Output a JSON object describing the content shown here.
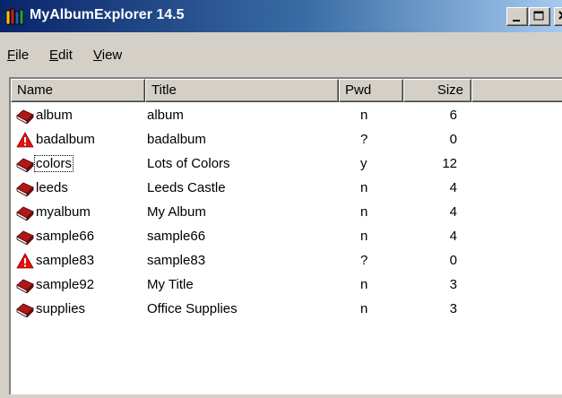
{
  "window": {
    "title": "MyAlbumExplorer 14.5",
    "colors": {
      "titlebar_start": "#0a246a",
      "titlebar_end": "#a6caf0",
      "face": "#d4d0c8"
    }
  },
  "menu": [
    {
      "mnemonic": "F",
      "rest": "ile"
    },
    {
      "mnemonic": "E",
      "rest": "dit"
    },
    {
      "mnemonic": "V",
      "rest": "iew"
    }
  ],
  "columns": {
    "name": "Name",
    "title": "Title",
    "pwd": "Pwd",
    "size": "Size"
  },
  "rows": [
    {
      "icon": "album-book-icon",
      "name": "album",
      "title": "album",
      "pwd": "n",
      "size": "6"
    },
    {
      "icon": "warning-icon",
      "name": "badalbum",
      "title": "badalbum",
      "pwd": "?",
      "size": "0"
    },
    {
      "icon": "album-book-icon",
      "name": "colors",
      "title": "Lots of Colors",
      "pwd": "y",
      "size": "12",
      "focused": true
    },
    {
      "icon": "album-book-icon",
      "name": "leeds",
      "title": "Leeds Castle",
      "pwd": "n",
      "size": "4"
    },
    {
      "icon": "album-book-icon",
      "name": "myalbum",
      "title": "My Album",
      "pwd": "n",
      "size": "4"
    },
    {
      "icon": "album-book-icon",
      "name": "sample66",
      "title": "sample66",
      "pwd": "n",
      "size": "4"
    },
    {
      "icon": "warning-icon",
      "name": "sample83",
      "title": "sample83",
      "pwd": "?",
      "size": "0"
    },
    {
      "icon": "album-book-icon",
      "name": "sample92",
      "title": "My Title",
      "pwd": "n",
      "size": "3"
    },
    {
      "icon": "album-book-icon",
      "name": "supplies",
      "title": "Office Supplies",
      "pwd": "n",
      "size": "3"
    }
  ]
}
